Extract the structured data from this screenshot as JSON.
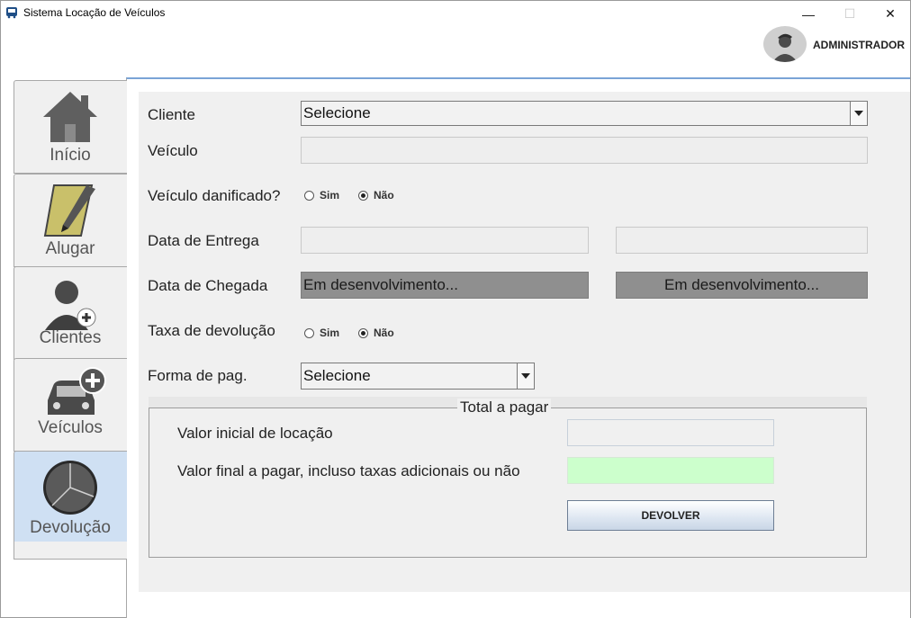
{
  "window": {
    "title": "Sistema Locação de Veículos",
    "controls": {
      "minimize": "—",
      "maximize": "☐",
      "close": "✕"
    }
  },
  "header": {
    "user": "ADMINISTRADOR"
  },
  "tabs": [
    {
      "label": "Início",
      "icon": "home-icon"
    },
    {
      "label": "Alugar",
      "icon": "pencil-paper-icon"
    },
    {
      "label": "Clientes",
      "icon": "add-user-icon"
    },
    {
      "label": "Veículos",
      "icon": "add-car-icon"
    },
    {
      "label": "Devolução",
      "icon": "pie-chart-icon",
      "active": true
    }
  ],
  "form": {
    "cliente_label": "Cliente",
    "cliente_value": "Selecione",
    "veiculo_label": "Veículo",
    "veiculo_value": "",
    "danificado_label": "Veículo danificado?",
    "danificado_options": [
      "Sim",
      "Não"
    ],
    "danificado_selected": "Não",
    "entrega_label": "Data de Entrega",
    "entrega_date": "",
    "entrega_time": "",
    "chegada_label": "Data de Chegada",
    "chegada_date": "Em desenvolvimento...",
    "chegada_time": "Em desenvolvimento...",
    "taxa_label": "Taxa de devolução",
    "taxa_options": [
      "Sim",
      "Não"
    ],
    "taxa_selected": "Não",
    "pagamento_label": "Forma de pag.",
    "pagamento_value": "Selecione"
  },
  "totals": {
    "title": "Total a pagar",
    "valor_inicial_label": "Valor inicial de locação",
    "valor_inicial_value": "",
    "valor_final_label": "Valor final a pagar, incluso taxas adicionais ou não",
    "valor_final_value": "",
    "devolver_button": "DEVOLVER"
  },
  "colors": {
    "active_tab": "#cfe0f3",
    "accent_border": "#7aa4d6",
    "final_value_bg": "#ccffcc",
    "disabled_field": "#8f8f8f"
  }
}
